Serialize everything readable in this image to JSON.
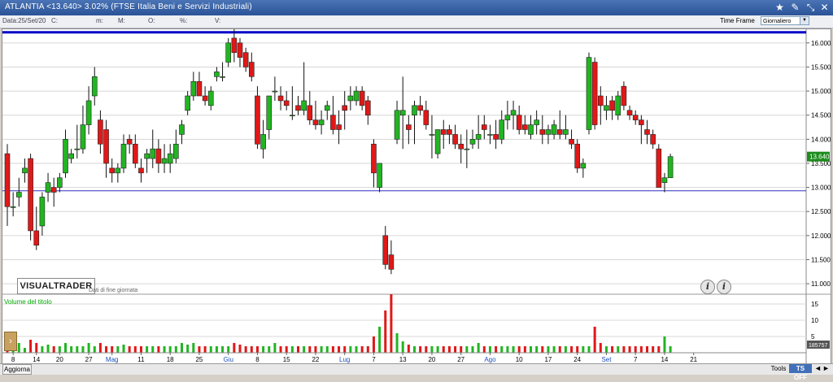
{
  "window": {
    "title": "ATLANTIA <13.640> 3.02%  (FTSE Italia Beni e Servizi Industriali)"
  },
  "info_bar": {
    "data_label": "Data:25/Set/20",
    "c_label": "C:",
    "m_label": "m:",
    "M_label": "M:",
    "o_label": "O:",
    "pct_label": "%:",
    "v_label": "V:",
    "time_frame_label": "Time Frame",
    "time_frame_value": "Giornaliero"
  },
  "chart": {
    "logo": "VISUALTRADER",
    "eod_note": "Dati di fine giornata",
    "volume_label": "Volume del titolo",
    "last_price_tag": "13.640",
    "volume_tag": "185757",
    "colors": {
      "up": "#22b522",
      "down": "#e01818",
      "resistance": "#0000c8",
      "support": "#3030c0"
    }
  },
  "chart_data": {
    "type": "candlestick",
    "title": "ATLANTIA <13.640> 3.02%  (FTSE Italia Beni e Servizi Industriali)",
    "ylim": [
      10.85,
      16.25
    ],
    "price_ticks": [
      "16.000",
      "15.500",
      "15.000",
      "14.500",
      "14.000",
      "13.500",
      "13.000",
      "12.500",
      "12.000",
      "11.500",
      "11.000"
    ],
    "price_tick_values": [
      16.0,
      15.5,
      15.0,
      14.5,
      14.0,
      13.5,
      13.0,
      12.5,
      12.0,
      11.5,
      11.0
    ],
    "resistance": 16.22,
    "support": 12.93,
    "volume_ylim": [
      0,
      17.5
    ],
    "volume_ticks": [
      "15",
      "10",
      "5"
    ],
    "volume_tick_values": [
      15,
      10,
      5
    ],
    "x_labels": [
      "8",
      "14",
      "20",
      "27",
      "Mag",
      "11",
      "18",
      "25",
      "Giu",
      "8",
      "15",
      "22",
      "Lug",
      "7",
      "13",
      "20",
      "27",
      "Ago",
      "10",
      "17",
      "24",
      "Set",
      "7",
      "14",
      "21"
    ],
    "x_label_positions": [
      1,
      5,
      9,
      14,
      18,
      23,
      28,
      33,
      38,
      43,
      48,
      53,
      58,
      63,
      68,
      73,
      78,
      83,
      88,
      93,
      98,
      103,
      108,
      113,
      118
    ],
    "month_labels": [
      "Mag",
      "Giu",
      "Lug",
      "Ago",
      "Set"
    ],
    "candles": [
      [
        13.7,
        13.9,
        12.2,
        12.6
      ],
      [
        12.6,
        12.9,
        12.4,
        12.6
      ],
      [
        12.8,
        13.2,
        12.6,
        12.9
      ],
      [
        13.3,
        13.6,
        13.1,
        13.4
      ],
      [
        13.6,
        13.7,
        11.9,
        12.1
      ],
      [
        12.1,
        12.6,
        11.7,
        11.8
      ],
      [
        12.2,
        12.9,
        12.0,
        12.8
      ],
      [
        12.9,
        13.3,
        12.7,
        13.1
      ],
      [
        13.0,
        13.2,
        12.6,
        12.9
      ],
      [
        13.0,
        13.3,
        12.9,
        13.2
      ],
      [
        13.3,
        14.2,
        13.2,
        14.0
      ],
      [
        13.6,
        13.8,
        13.5,
        13.7
      ],
      [
        13.8,
        14.3,
        13.6,
        13.8
      ],
      [
        13.8,
        14.7,
        13.7,
        14.3
      ],
      [
        14.3,
        15.1,
        14.1,
        14.8
      ],
      [
        14.9,
        15.5,
        14.7,
        15.3
      ],
      [
        14.4,
        14.6,
        13.7,
        13.9
      ],
      [
        14.2,
        14.4,
        13.2,
        13.5
      ],
      [
        13.4,
        13.6,
        13.1,
        13.3
      ],
      [
        13.3,
        13.5,
        13.1,
        13.4
      ],
      [
        13.4,
        14.1,
        13.3,
        13.9
      ],
      [
        14.0,
        14.1,
        13.7,
        13.9
      ],
      [
        13.9,
        14.1,
        13.4,
        13.5
      ],
      [
        13.4,
        13.6,
        13.1,
        13.3
      ],
      [
        13.6,
        13.8,
        13.3,
        13.7
      ],
      [
        13.6,
        14.2,
        13.4,
        13.8
      ],
      [
        13.8,
        14.0,
        13.3,
        13.5
      ],
      [
        13.5,
        13.9,
        13.3,
        13.6
      ],
      [
        13.5,
        13.9,
        13.3,
        13.7
      ],
      [
        13.6,
        14.2,
        13.5,
        13.9
      ],
      [
        14.1,
        14.4,
        13.9,
        14.3
      ],
      [
        14.6,
        15.0,
        14.5,
        14.9
      ],
      [
        14.9,
        15.4,
        14.8,
        15.2
      ],
      [
        15.2,
        15.4,
        14.9,
        14.9
      ],
      [
        14.9,
        15.1,
        14.7,
        14.8
      ],
      [
        14.7,
        15.1,
        14.6,
        15.0
      ],
      [
        15.3,
        15.5,
        15.2,
        15.4
      ],
      [
        15.3,
        15.6,
        15.2,
        15.3
      ],
      [
        15.6,
        16.1,
        15.5,
        16.0
      ],
      [
        16.1,
        16.3,
        15.6,
        15.8
      ],
      [
        16.0,
        16.1,
        15.5,
        15.7
      ],
      [
        15.8,
        15.9,
        15.4,
        15.5
      ],
      [
        15.6,
        15.8,
        15.2,
        15.3
      ],
      [
        14.9,
        15.1,
        13.8,
        13.9
      ],
      [
        13.8,
        14.4,
        13.6,
        14.1
      ],
      [
        14.2,
        14.8,
        14.0,
        14.9
      ],
      [
        15.0,
        15.3,
        14.8,
        15.0
      ],
      [
        14.9,
        15.1,
        14.6,
        14.8
      ],
      [
        14.8,
        15.0,
        14.6,
        14.7
      ],
      [
        14.5,
        15.1,
        14.4,
        14.5
      ],
      [
        14.7,
        14.9,
        14.5,
        14.6
      ],
      [
        14.6,
        15.6,
        14.5,
        14.8
      ],
      [
        14.7,
        15.0,
        14.3,
        14.4
      ],
      [
        14.4,
        14.8,
        14.2,
        14.3
      ],
      [
        14.3,
        14.6,
        14.1,
        14.4
      ],
      [
        14.6,
        14.8,
        14.4,
        14.7
      ],
      [
        14.5,
        14.9,
        14.1,
        14.2
      ],
      [
        14.3,
        14.6,
        13.9,
        14.2
      ],
      [
        14.7,
        15.0,
        14.2,
        14.6
      ],
      [
        14.8,
        15.1,
        14.6,
        14.9
      ],
      [
        14.8,
        15.1,
        14.7,
        15.0
      ],
      [
        15.0,
        15.1,
        14.6,
        14.7
      ],
      [
        14.8,
        14.9,
        14.3,
        14.5
      ],
      [
        13.9,
        14.0,
        13.0,
        13.3
      ],
      [
        13.0,
        13.5,
        12.9,
        13.5
      ],
      [
        12.0,
        12.2,
        11.3,
        11.4
      ],
      [
        11.6,
        11.9,
        11.2,
        11.3
      ],
      [
        14.0,
        14.8,
        13.9,
        14.6
      ],
      [
        14.5,
        15.3,
        13.8,
        14.6
      ],
      [
        14.3,
        14.5,
        13.9,
        14.2
      ],
      [
        14.5,
        14.8,
        13.9,
        14.7
      ],
      [
        14.7,
        14.9,
        14.5,
        14.6
      ],
      [
        14.6,
        14.8,
        14.2,
        14.3
      ],
      [
        14.1,
        14.5,
        13.6,
        14.1
      ],
      [
        13.7,
        14.2,
        13.6,
        14.2
      ],
      [
        14.2,
        14.4,
        13.8,
        14.1
      ],
      [
        14.2,
        14.3,
        13.9,
        14.1
      ],
      [
        14.1,
        14.3,
        13.8,
        13.9
      ],
      [
        13.9,
        14.1,
        13.5,
        13.8
      ],
      [
        13.8,
        14.2,
        13.4,
        13.8
      ],
      [
        13.9,
        14.2,
        13.8,
        14.0
      ],
      [
        14.0,
        14.5,
        13.8,
        14.1
      ],
      [
        14.3,
        14.5,
        14.0,
        14.2
      ],
      [
        14.1,
        14.3,
        13.9,
        14.1
      ],
      [
        14.1,
        14.4,
        13.8,
        14.0
      ],
      [
        14.0,
        14.6,
        13.9,
        14.4
      ],
      [
        14.4,
        14.8,
        14.2,
        14.5
      ],
      [
        14.5,
        14.8,
        14.2,
        14.6
      ],
      [
        14.5,
        14.7,
        14.1,
        14.2
      ],
      [
        14.3,
        14.5,
        14.1,
        14.2
      ],
      [
        14.1,
        14.5,
        14.0,
        14.3
      ],
      [
        14.3,
        14.6,
        14.1,
        14.4
      ],
      [
        14.2,
        14.5,
        13.9,
        14.1
      ],
      [
        14.1,
        14.3,
        13.9,
        14.2
      ],
      [
        14.1,
        14.4,
        14.0,
        14.3
      ],
      [
        14.2,
        14.6,
        14.0,
        14.1
      ],
      [
        14.1,
        14.5,
        14.0,
        14.2
      ],
      [
        14.0,
        14.2,
        13.8,
        13.9
      ],
      [
        13.9,
        14.0,
        13.3,
        13.4
      ],
      [
        13.4,
        13.6,
        13.2,
        13.5
      ],
      [
        14.2,
        15.8,
        14.1,
        15.7
      ],
      [
        15.6,
        15.7,
        14.2,
        14.3
      ],
      [
        14.9,
        15.1,
        14.3,
        14.7
      ],
      [
        14.6,
        14.9,
        14.4,
        14.7
      ],
      [
        14.8,
        14.9,
        14.4,
        14.6
      ],
      [
        14.5,
        15.0,
        14.4,
        14.9
      ],
      [
        15.1,
        15.2,
        14.6,
        14.7
      ],
      [
        14.6,
        14.7,
        14.4,
        14.5
      ],
      [
        14.5,
        14.6,
        14.3,
        14.4
      ],
      [
        14.4,
        14.5,
        13.9,
        14.3
      ],
      [
        14.2,
        14.4,
        13.9,
        14.1
      ],
      [
        14.1,
        14.2,
        13.8,
        13.9
      ],
      [
        13.8,
        13.9,
        13.1,
        13.0
      ],
      [
        13.1,
        13.3,
        12.9,
        13.2
      ],
      [
        13.2,
        13.7,
        13.2,
        13.64
      ]
    ],
    "volumes": [
      2,
      2,
      3,
      1.5,
      4,
      3,
      2,
      2.5,
      2,
      2,
      3,
      2,
      2,
      2,
      3,
      2,
      3,
      2,
      2,
      2,
      2.5,
      2,
      2,
      2,
      2,
      2,
      2,
      2,
      2,
      2,
      3,
      2.5,
      3,
      2,
      2,
      2,
      2,
      2,
      2,
      3,
      2.5,
      2,
      2,
      2,
      2,
      2,
      3,
      2,
      2,
      2,
      2,
      2,
      2,
      2,
      2,
      2,
      2,
      2,
      2,
      2,
      2,
      2,
      2,
      5,
      8,
      13,
      18,
      6,
      3.5,
      2.5,
      2,
      2,
      2,
      2,
      2,
      2,
      2,
      2,
      2,
      2,
      2,
      3,
      2,
      2,
      2,
      2,
      2,
      2,
      2,
      2,
      2,
      2,
      2,
      2,
      2,
      2,
      2,
      2,
      2,
      2,
      2,
      8,
      3,
      2,
      2,
      2,
      2,
      2,
      2,
      2,
      2,
      2,
      2,
      5,
      2,
      2,
      2,
      2,
      2,
      2,
      2
    ]
  }
}
